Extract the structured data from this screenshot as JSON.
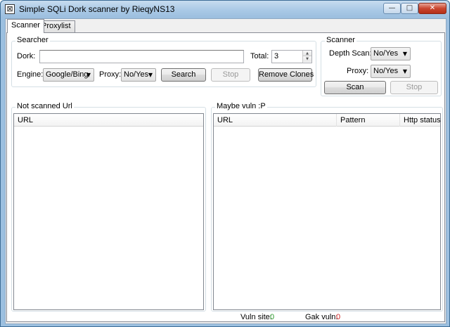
{
  "window": {
    "title": "Simple SQLi Dork scanner by RieqyNS13",
    "minimize_glyph": "—",
    "maximize_glyph": "□",
    "close_glyph": "✕",
    "app_icon_glyph": "⊠"
  },
  "tabs": [
    {
      "label": "Scanner",
      "active": true
    },
    {
      "label": "Proxylist",
      "active": false
    }
  ],
  "searcher": {
    "legend": "Searcher",
    "dork_label": "Dork:",
    "dork_value": "",
    "total_label": "Total:",
    "total_value": "3",
    "engine_label": "Engine:",
    "engine_value": "Google/Bing",
    "proxy_label": "Proxy:",
    "proxy_value": "No/Yes",
    "search_button": "Search",
    "stop_button": "Stop",
    "remove_clones_button": "Remove Clones"
  },
  "scanner": {
    "legend": "Scanner",
    "depth_label": "Depth Scan:",
    "depth_value": "No/Yes",
    "proxy_label": "Proxy:",
    "proxy_value": "No/Yes",
    "scan_button": "Scan",
    "stop_button": "Stop"
  },
  "not_scanned": {
    "legend": "Not scanned Url",
    "columns": [
      "URL"
    ],
    "rows": []
  },
  "maybe_vuln": {
    "legend": "Maybe vuln :P",
    "columns": [
      "URL",
      "Pattern",
      "Http status"
    ],
    "rows": []
  },
  "status": {
    "vuln_label": "Vuln site:",
    "vuln_count": "0",
    "gak_label": "Gak vuln:",
    "gak_count": "0"
  },
  "colors": {
    "vuln_count": "#2a9a2a",
    "gak_count": "#cc2222",
    "titlebar": "#aac9e6"
  }
}
